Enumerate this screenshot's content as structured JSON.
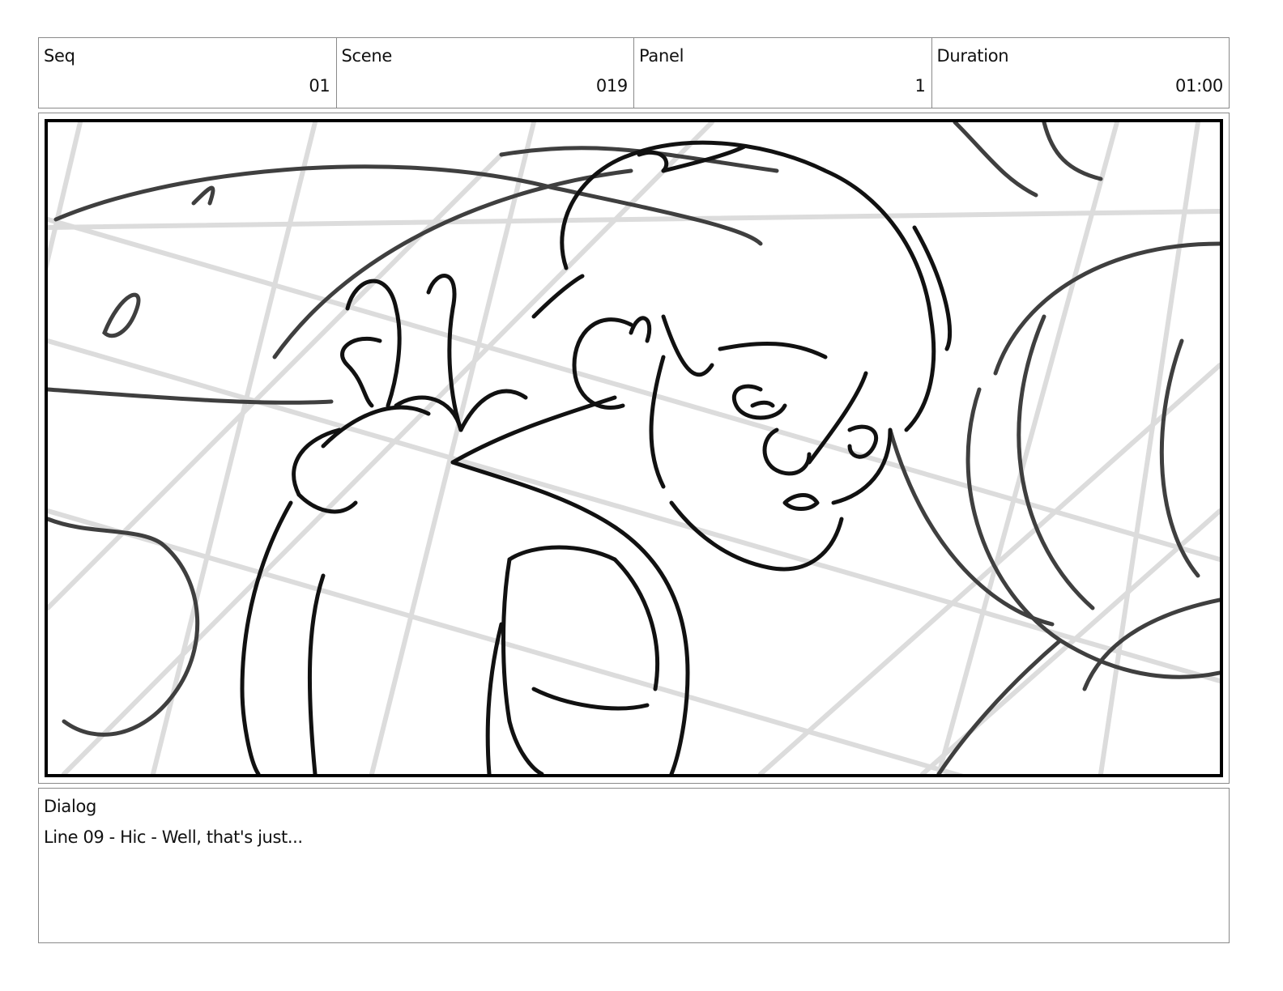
{
  "header": {
    "seq": {
      "label": "Seq",
      "value": "01"
    },
    "scene": {
      "label": "Scene",
      "value": "019"
    },
    "panel": {
      "label": "Panel",
      "value": "1"
    },
    "duration": {
      "label": "Duration",
      "value": "01:00"
    }
  },
  "artwork": {
    "subject": "rough storyboard sketch"
  },
  "dialog": {
    "label": "Dialog",
    "text": "Line 09 - Hic - Well, that's just..."
  }
}
